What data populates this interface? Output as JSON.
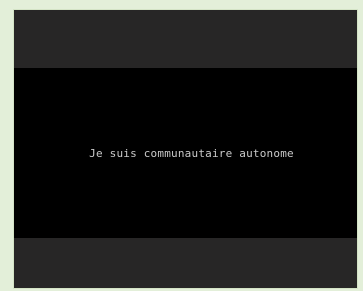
{
  "video": {
    "caption": "Je suis communautaire autonome"
  },
  "colors": {
    "page_background": "#e3efd9",
    "player_bar": "#272626",
    "video_background": "#000000",
    "caption_text": "#c9c9c9"
  }
}
